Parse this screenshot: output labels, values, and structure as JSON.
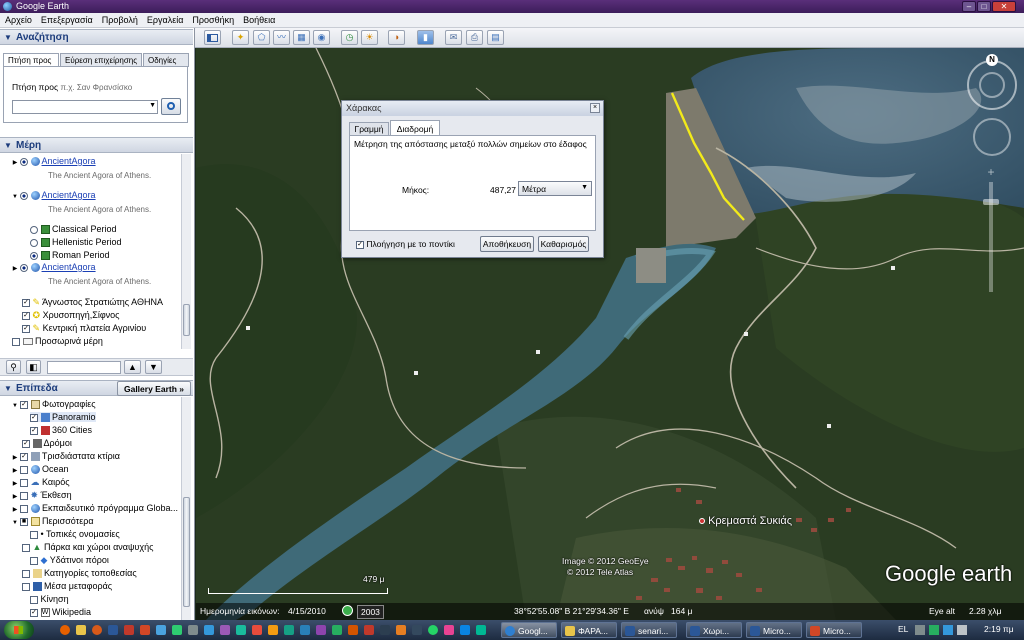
{
  "window": {
    "title": "Google Earth"
  },
  "menu": [
    "Αρχείο",
    "Επεξεργασία",
    "Προβολή",
    "Εργαλεία",
    "Προσθήκη",
    "Βοήθεια"
  ],
  "search": {
    "header": "Αναζήτηση",
    "tabs": [
      "Πτήση προς",
      "Εύρεση επιχείρησης",
      "Οδηγίες"
    ],
    "label": "Πτήση προς",
    "hint": "π.χ. Σαν Φρανσίσκο",
    "value": ""
  },
  "places": {
    "header": "Μέρη",
    "items": [
      {
        "title": "AncientAgora",
        "desc": "The Ancient Agora of Athens."
      },
      {
        "title": "AncientAgora",
        "desc": "The Ancient Agora of Athens."
      },
      {
        "title": "Classical Period"
      },
      {
        "title": "Hellenistic Period"
      },
      {
        "title": "Roman Period"
      },
      {
        "title": "AncientAgora",
        "desc": "The Ancient Agora of Athens."
      },
      {
        "title": "Άγνωστος Στρατιώτης ΑΘΗΝΑ"
      },
      {
        "title": "Χρυσοπηγή,Σίφνος"
      },
      {
        "title": "Κεντρική πλατεία Αγρινίου"
      },
      {
        "title": "Προσωρινά μέρη"
      }
    ]
  },
  "layers": {
    "header": "Επίπεδα",
    "gallery_button": "Gallery Earth »",
    "items": [
      "Φωτογραφίες",
      "Panoramio",
      "360 Cities",
      "Δρόμοι",
      "Τρισδιάστατα κτίρια",
      "Ocean",
      "Καιρός",
      "Έκθεση",
      "Εκπαιδευτικό πρόγραμμα Globa...",
      "Περισσότερα",
      "Τοπικές ονομασίες",
      "Πάρκα και χώροι αναψυχής",
      "Υδάτινοι πόροι",
      "Κατηγορίες τοποθεσίας",
      "Μέσα μεταφοράς",
      "Κίνηση",
      "Wikipedia"
    ]
  },
  "ruler": {
    "title": "Χάρακας",
    "tabs": [
      "Γραμμή",
      "Διαδρομή"
    ],
    "description": "Μέτρηση της απόστασης μεταξύ πολλών σημείων στο έδαφος",
    "length_label": "Μήκος:",
    "length_value": "487,27",
    "unit": "Μέτρα",
    "mouse_nav_label": "Πλοήγηση με το ποντίκι",
    "save_button": "Αποθήκευση",
    "clear_button": "Καθαρισμός"
  },
  "map": {
    "place_label": "Κρεμαστά Συκιάς",
    "scale_label": "479 μ",
    "copyright1": "Image © 2012 GeoEye",
    "copyright2": "© 2012 Tele Atlas",
    "logo": "Google earth",
    "compass_n": "N"
  },
  "status": {
    "imagery_label": "Ημερομηνία εικόνων:",
    "imagery_date": "4/15/2010",
    "year": "2003",
    "coords": "38°52'55.08\" Β 21°29'34.36\" Ε",
    "elev_label": "ανύψ",
    "elev": "164 μ",
    "eye_label": "Eye alt",
    "eye": "2.28 χλμ"
  },
  "taskbar": {
    "tasks": [
      "Googl...",
      "ΦΑΡΑ...",
      "senari...",
      "Χωρι...",
      "Micro...",
      "Micro..."
    ],
    "lang": "EL",
    "time": "2:19 πμ"
  },
  "colors": {
    "accent": "#1c3c7c",
    "path": "#f2ea1a",
    "title_bar": "#3c1d5a"
  }
}
